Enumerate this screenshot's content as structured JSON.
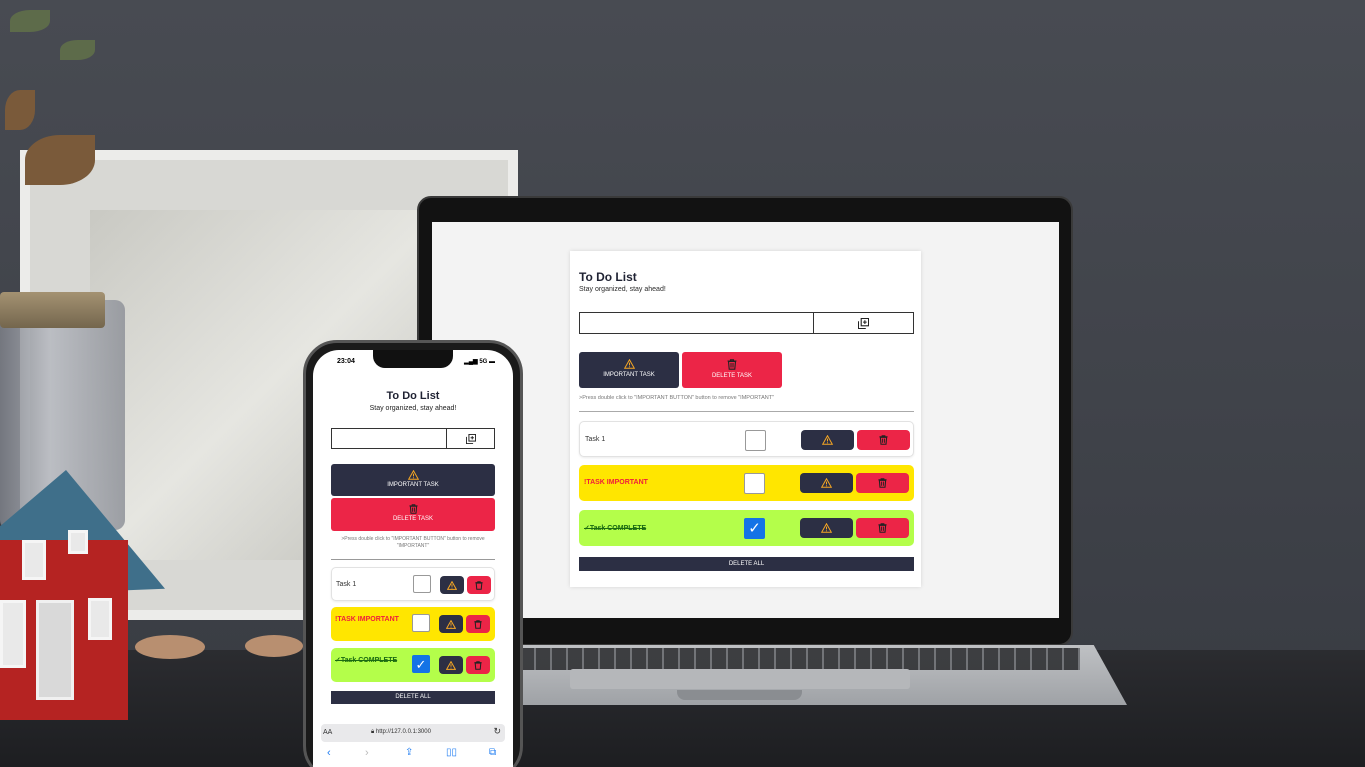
{
  "desktop_app": {
    "title": "To Do List",
    "subtitle": "Stay organized, stay ahead!",
    "important_button": "IMPORTANT TASK",
    "delete_button": "DELETE TASK",
    "hint": ">Press double click to \"IMPORTANT BUTTON\" button to remove \"IMPORTANT\"",
    "tasks": [
      {
        "label": "Task 1",
        "state": "normal",
        "checked": false
      },
      {
        "label": "!TASK IMPORTANT",
        "state": "important",
        "checked": false
      },
      {
        "label": "✓Task COMPLETE",
        "state": "complete",
        "checked": true
      }
    ],
    "delete_all": "DELETE ALL"
  },
  "mobile_app": {
    "status_time": "23:04",
    "status_signal": "5G",
    "title": "To Do List",
    "subtitle": "Stay organized, stay ahead!",
    "important_button": "IMPORTANT TASK",
    "delete_button": "DELETE TASK",
    "hint": ">Press double click to \"IMPORTANT BUTTON\" button to remove \"IMPORTANT\"",
    "tasks": [
      {
        "label": "Task 1",
        "state": "normal",
        "checked": false
      },
      {
        "label": "!TASK IMPORTANT",
        "state": "important",
        "checked": false
      },
      {
        "label": "✓Task COMPLETE",
        "state": "complete",
        "checked": true
      }
    ],
    "delete_all": "DELETE ALL",
    "browser": {
      "text_size": "AA",
      "url": "http://127.0.0.1:3000"
    }
  },
  "colors": {
    "navy": "#2c2f44",
    "red": "#ec2547",
    "important_row": "#ffe600",
    "complete_row": "#b4fe4a",
    "checkbox_checked": "#1473e6",
    "warning_icon": "#f5a623"
  },
  "icons": [
    "warning-icon",
    "trash-icon",
    "copy-add-icon",
    "checkmark-icon",
    "lock-icon",
    "reload-icon",
    "back-icon",
    "forward-icon",
    "share-icon",
    "bookmarks-icon",
    "tabs-icon"
  ]
}
